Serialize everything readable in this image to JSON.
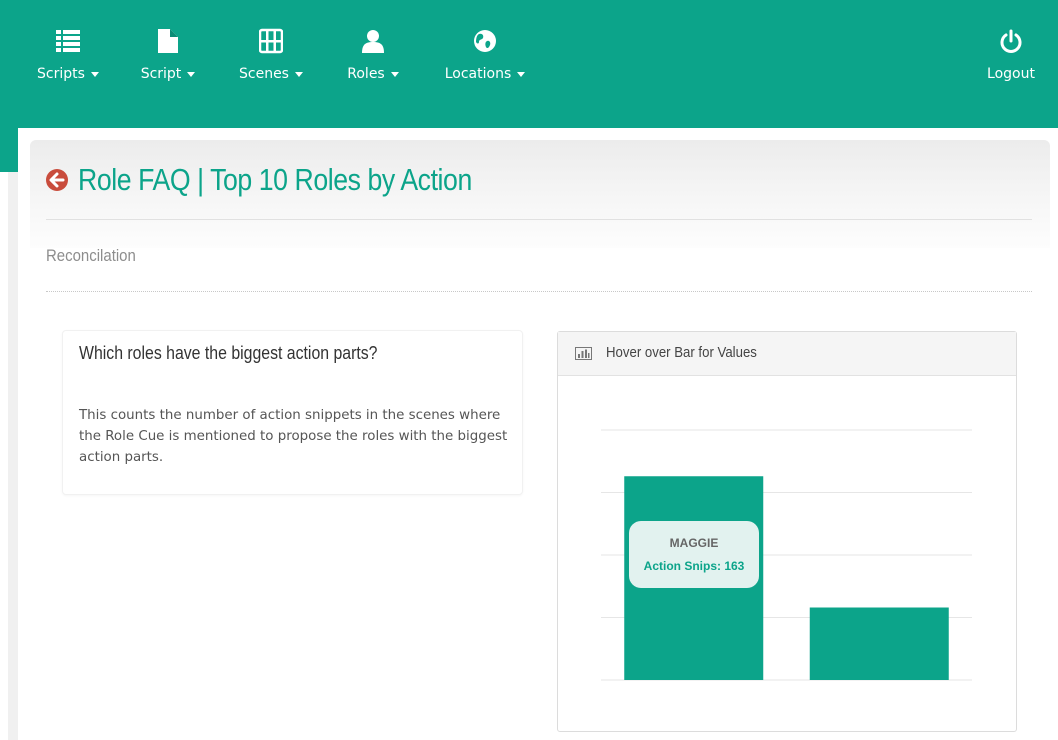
{
  "navbar": {
    "items": [
      {
        "label": "Scripts",
        "icon": "list-icon"
      },
      {
        "label": "Script",
        "icon": "file-icon"
      },
      {
        "label": "Scenes",
        "icon": "film-icon"
      },
      {
        "label": "Roles",
        "icon": "user-icon"
      },
      {
        "label": "Locations",
        "icon": "globe-icon"
      }
    ],
    "logout": {
      "label": "Logout",
      "icon": "power-icon"
    },
    "background_color": "#0ca48a"
  },
  "page": {
    "title": "Role FAQ | Top 10 Roles by Action",
    "subtitle": "Reconcilation",
    "back_icon": "arrow-circle-left-icon",
    "accent_color": "#0ca48a",
    "back_icon_color": "#c94c3c"
  },
  "info_card": {
    "question": "Which roles have the biggest action parts?",
    "body": "This counts the number of action snippets in the scenes where the Role Cue is mentioned to propose the roles with the biggest action parts."
  },
  "chart_panel": {
    "header_icon": "bar-chart-icon",
    "header_title": "Hover over Bar for Values"
  },
  "chart_data": {
    "type": "bar",
    "categories": [
      "MAGGIE",
      ""
    ],
    "series": [
      {
        "name": "Action Snips",
        "values": [
          163,
          58
        ],
        "color": "#0ca48a"
      }
    ],
    "ylim": [
      0,
      200
    ],
    "grid": true,
    "title": "",
    "xlabel": "",
    "ylabel": "",
    "tooltip": {
      "category": "MAGGIE",
      "series_label": "Action Snips",
      "value": 163,
      "text": "Action Snips: 163"
    }
  }
}
